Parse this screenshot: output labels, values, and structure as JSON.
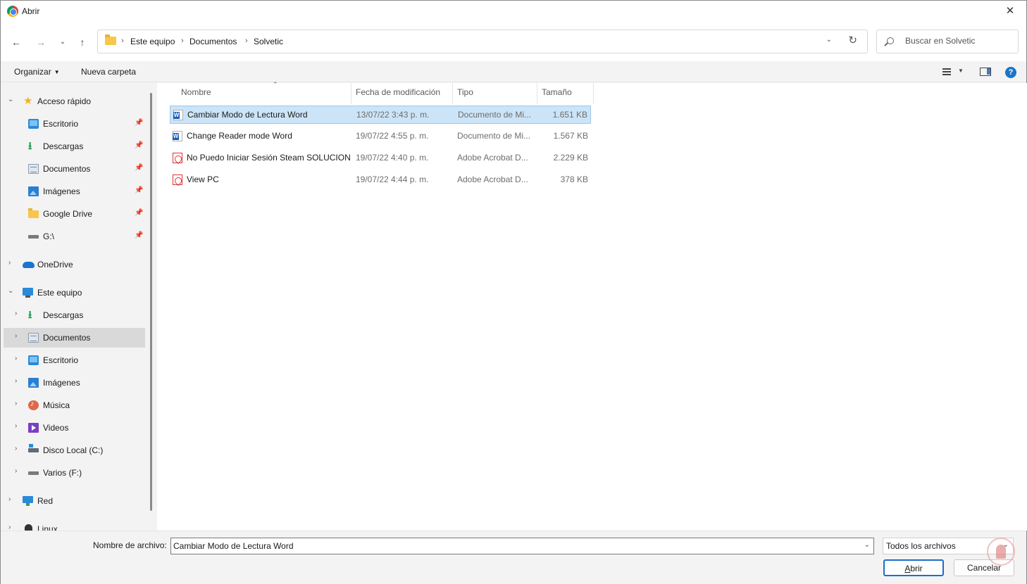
{
  "window": {
    "title": "Abrir",
    "close_glyph": "✕"
  },
  "nav": {
    "back": "←",
    "forward": "→",
    "recent": "⌄",
    "up": "↑",
    "breadcrumbs": [
      "Este equipo",
      "Documentos",
      "Solvetic"
    ],
    "separator": "›",
    "dropdown": "⌄",
    "refresh": "↻",
    "search_placeholder": "Buscar en Solvetic"
  },
  "toolbar": {
    "organize": "Organizar",
    "organize_caret": "▼",
    "new_folder": "Nueva carpeta",
    "view_caret": "▼",
    "help": "?"
  },
  "sidebar": {
    "chev_expanded": "⌄",
    "chev_collapsed": "›",
    "pin": "📌",
    "items": [
      {
        "label": "Acceso rápido",
        "icon": "star-icon"
      },
      {
        "label": "Escritorio",
        "icon": "desktop-icon"
      },
      {
        "label": "Descargas",
        "icon": "download-icon"
      },
      {
        "label": "Documentos",
        "icon": "documents-icon"
      },
      {
        "label": "Imágenes",
        "icon": "images-icon"
      },
      {
        "label": "Google Drive",
        "icon": "folder-icon"
      },
      {
        "label": "G:\\",
        "icon": "drive-icon"
      },
      {
        "label": "OneDrive",
        "icon": "onedrive-icon"
      },
      {
        "label": "Este equipo",
        "icon": "pc-icon"
      },
      {
        "label": "Descargas",
        "icon": "download-icon"
      },
      {
        "label": "Documentos",
        "icon": "documents-icon"
      },
      {
        "label": "Escritorio",
        "icon": "desktop-icon"
      },
      {
        "label": "Imágenes",
        "icon": "images-icon"
      },
      {
        "label": "Música",
        "icon": "music-icon"
      },
      {
        "label": "Videos",
        "icon": "videos-icon"
      },
      {
        "label": "Disco Local (C:)",
        "icon": "disk-icon"
      },
      {
        "label": "Varios (F:)",
        "icon": "drive-icon"
      },
      {
        "label": "Red",
        "icon": "network-icon"
      },
      {
        "label": "Linux",
        "icon": "linux-icon"
      }
    ]
  },
  "list": {
    "sort_caret": "⌃",
    "columns": [
      "Nombre",
      "Fecha de modificación",
      "Tipo",
      "Tamaño"
    ],
    "rows": [
      {
        "name": "Cambiar Modo de Lectura Word",
        "date": "13/07/22 3:43 p. m.",
        "type": "Documento de Mi...",
        "size": "1.651 KB",
        "icon": "word-icon"
      },
      {
        "name": "Change Reader mode Word",
        "date": "19/07/22 4:55 p. m.",
        "type": "Documento de Mi...",
        "size": "1.567 KB",
        "icon": "word-icon"
      },
      {
        "name": "No Puedo Iniciar Sesión Steam  SOLUCION",
        "date": "19/07/22 4:40 p. m.",
        "type": "Adobe Acrobat D...",
        "size": "2.229 KB",
        "icon": "pdf-icon"
      },
      {
        "name": "View PC",
        "date": "19/07/22 4:44 p. m.",
        "type": "Adobe Acrobat D...",
        "size": "378 KB",
        "icon": "pdf-icon"
      }
    ]
  },
  "bottom": {
    "filename_label": "Nombre de archivo:",
    "filename_value": "Cambiar Modo de Lectura Word",
    "filename_caret": "⌄",
    "filetype": "Todos los archivos",
    "filetype_caret": "⌄",
    "open_first": "A",
    "open_rest": "brir",
    "cancel": "Cancelar"
  },
  "colors": {
    "accent": "#1a6fc9",
    "selection": "#cce4f7",
    "sidebar_selected": "#d9d9d9"
  }
}
